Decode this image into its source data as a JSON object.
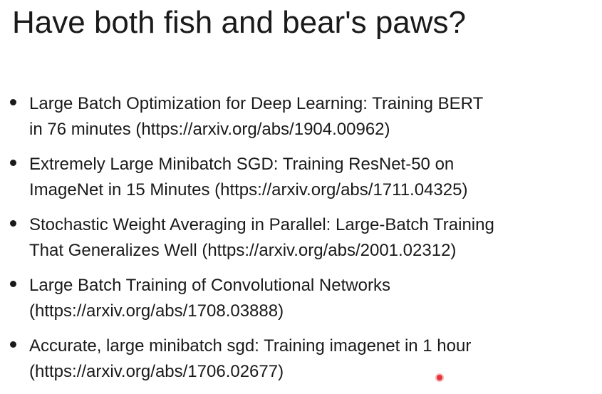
{
  "slide": {
    "title": "Have both fish and bear's paws?",
    "bullets": [
      {
        "line1": "Large Batch Optimization for Deep Learning: Training BERT",
        "line2": "in 76 minutes (https://arxiv.org/abs/1904.00962)"
      },
      {
        "line1": "Extremely Large Minibatch SGD: Training ResNet-50 on",
        "line2": "ImageNet in 15 Minutes (https://arxiv.org/abs/1711.04325)"
      },
      {
        "line1": "Stochastic Weight Averaging in Parallel: Large-Batch Training",
        "line2": "That Generalizes Well (https://arxiv.org/abs/2001.02312)"
      },
      {
        "line1": "Large Batch Training of Convolutional Networks",
        "line2": "(https://arxiv.org/abs/1708.03888)"
      },
      {
        "line1": "Accurate, large minibatch sgd: Training imagenet in 1 hour",
        "line2": "(https://arxiv.org/abs/1706.02677)"
      }
    ]
  },
  "colors": {
    "text": "#1a1a1a",
    "background": "#ffffff",
    "pointer": "#e7363b"
  },
  "icons": {
    "pointer": "laser-pointer-dot-icon"
  }
}
